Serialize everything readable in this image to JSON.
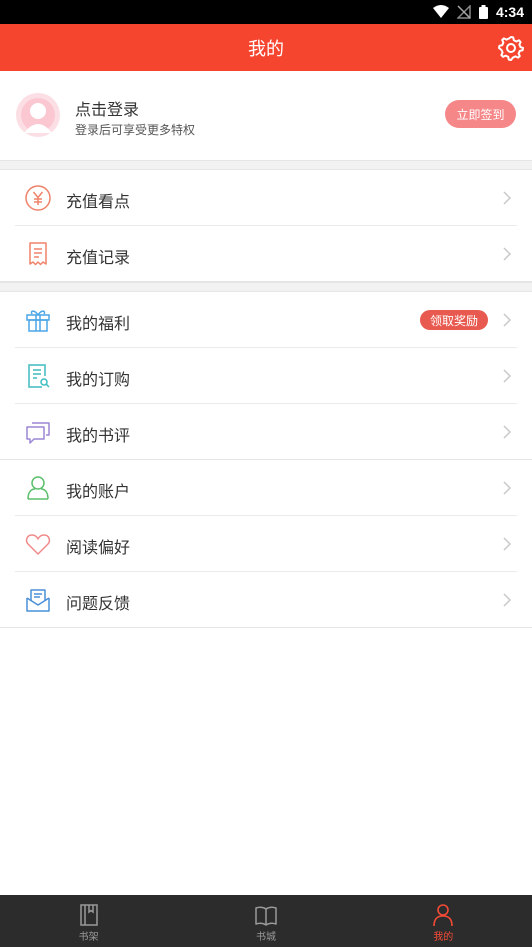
{
  "status_bar": {
    "time": "4:34"
  },
  "header": {
    "title": "我的"
  },
  "profile": {
    "login_title": "点击登录",
    "login_subtitle": "登录后可享受更多特权",
    "signin_label": "立即签到"
  },
  "menu": {
    "recharge": "充值看点",
    "recharge_history": "充值记录",
    "welfare": "我的福利",
    "welfare_badge": "领取奖励",
    "subscriptions": "我的订购",
    "reviews": "我的书评",
    "account": "我的账户",
    "preferences": "阅读偏好",
    "feedback": "问题反馈"
  },
  "bottom_nav": {
    "items": [
      {
        "label": "书架",
        "icon": "bookshelf-icon"
      },
      {
        "label": "书城",
        "icon": "open-book-icon"
      },
      {
        "label": "我的",
        "icon": "person-icon",
        "active": true
      }
    ]
  },
  "colors": {
    "accent": "#f6452f",
    "nav_bg": "#2c2c2c",
    "badge": "#e85a4f",
    "signin": "#f68789"
  }
}
